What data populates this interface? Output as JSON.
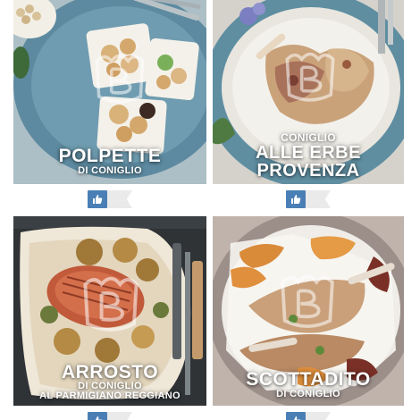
{
  "cards": [
    {
      "title": "POLPETTE",
      "subtitle": "DI CONIGLIO",
      "title2": ""
    },
    {
      "title": "ALLE ERBE",
      "title_top": "CONIGLIO",
      "title2": "PROVENZA"
    },
    {
      "title": "ARROSTO",
      "subtitle": "DI CONIGLIO",
      "subtitle2": "AL PARMIGIANO REGGIANO"
    },
    {
      "title": "SCOTTADITO",
      "subtitle": "DI CONIGLIO"
    }
  ],
  "like": {
    "icon": "thumbs-up-icon"
  },
  "colors": {
    "like_blue": "#4a7fb6",
    "tag_grey": "#eaeaea",
    "text": "#ffffff"
  }
}
